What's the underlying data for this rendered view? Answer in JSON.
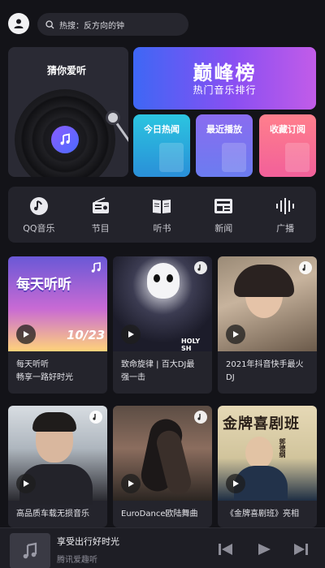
{
  "search": {
    "placeholder": "热搜：反方向的钟"
  },
  "featured": {
    "guess": "猜你爱听",
    "chart_logo": "巅峰榜",
    "chart_sub": "热门音乐排行",
    "mini": [
      "今日热闻",
      "最近播放",
      "收藏订阅"
    ]
  },
  "categories": [
    {
      "label": "QQ音乐",
      "icon": "qq-music-icon"
    },
    {
      "label": "节目",
      "icon": "radio-icon"
    },
    {
      "label": "听书",
      "icon": "book-icon"
    },
    {
      "label": "新闻",
      "icon": "news-icon"
    },
    {
      "label": "广播",
      "icon": "broadcast-icon"
    }
  ],
  "cards": [
    {
      "title": "每天听听\n畅享一路好时光",
      "thumb_text": "每天听听",
      "thumb_num": "10/23"
    },
    {
      "title": "致命旋律 | 百大DJ最\n强一击",
      "thumb_text": "HOLY SH"
    },
    {
      "title": "2021年抖音快手最火\nDJ"
    },
    {
      "title": "高品质车载无损音乐"
    },
    {
      "title": "EuroDance欧陆舞曲"
    },
    {
      "title": "《金牌喜剧班》亮相",
      "thumb_text": "金牌喜剧班",
      "thumb_small": "郭德纲"
    }
  ],
  "player": {
    "title": "享受出行好时光",
    "subtitle": "腾讯爱趣听"
  },
  "colors": {
    "background": "#131318",
    "card": "#24242c",
    "accent_blue": "#3e67f5",
    "accent_pink": "#f2609a"
  }
}
